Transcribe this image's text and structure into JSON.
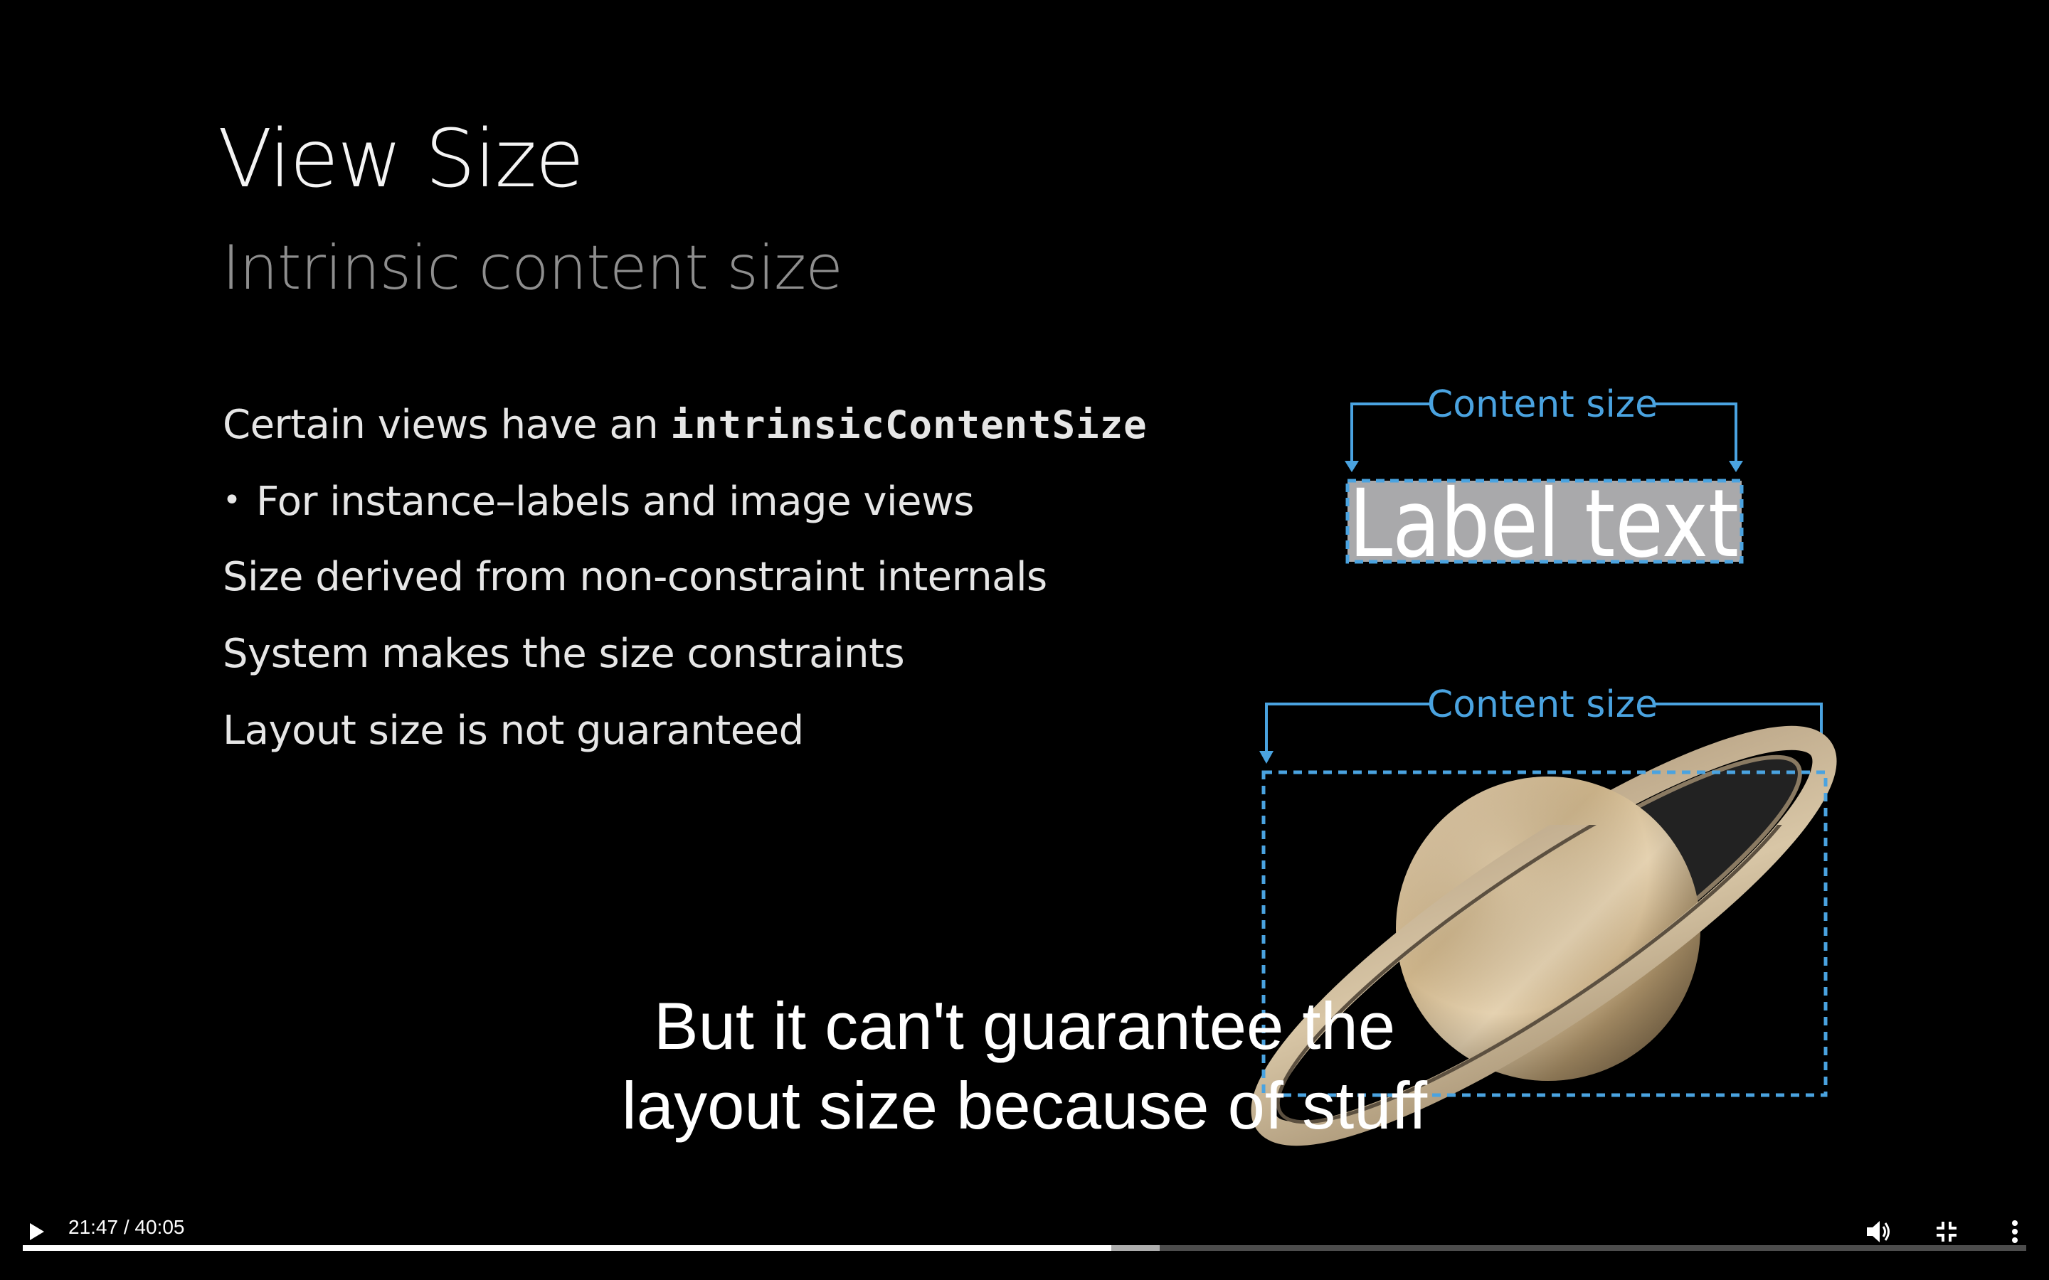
{
  "slide": {
    "title": "View Size",
    "subtitle": "Intrinsic content size",
    "line1_prefix": "Certain views have an ",
    "line1_code": "intrinsicContentSize",
    "sub_bullet_marker": "•",
    "sub_bullet": "For instance–labels and image views",
    "line3": "Size derived from non-constraint internals",
    "line4": "System makes the size constraints",
    "line5": "Layout size is not guaranteed"
  },
  "diagram": {
    "label_bracket_text": "Content size",
    "label_sample_text": "Label text",
    "image_bracket_text": "Content size",
    "image_subject": "saturn-planet-image",
    "accent_color": "#4aa3e0"
  },
  "captions": {
    "line1": "But it can't guarantee the",
    "line2": "layout size because of stuff"
  },
  "player": {
    "current_time": "21:47",
    "separator": " / ",
    "duration": "40:05",
    "time_display": "21:47 / 40:05",
    "progress_fraction": 0.5435,
    "buffered_fraction": 0.5675,
    "play_icon": "play-icon",
    "volume_icon": "volume-icon",
    "exit_fullscreen_icon": "exit-fullscreen-icon",
    "more_icon": "more-options-icon"
  }
}
